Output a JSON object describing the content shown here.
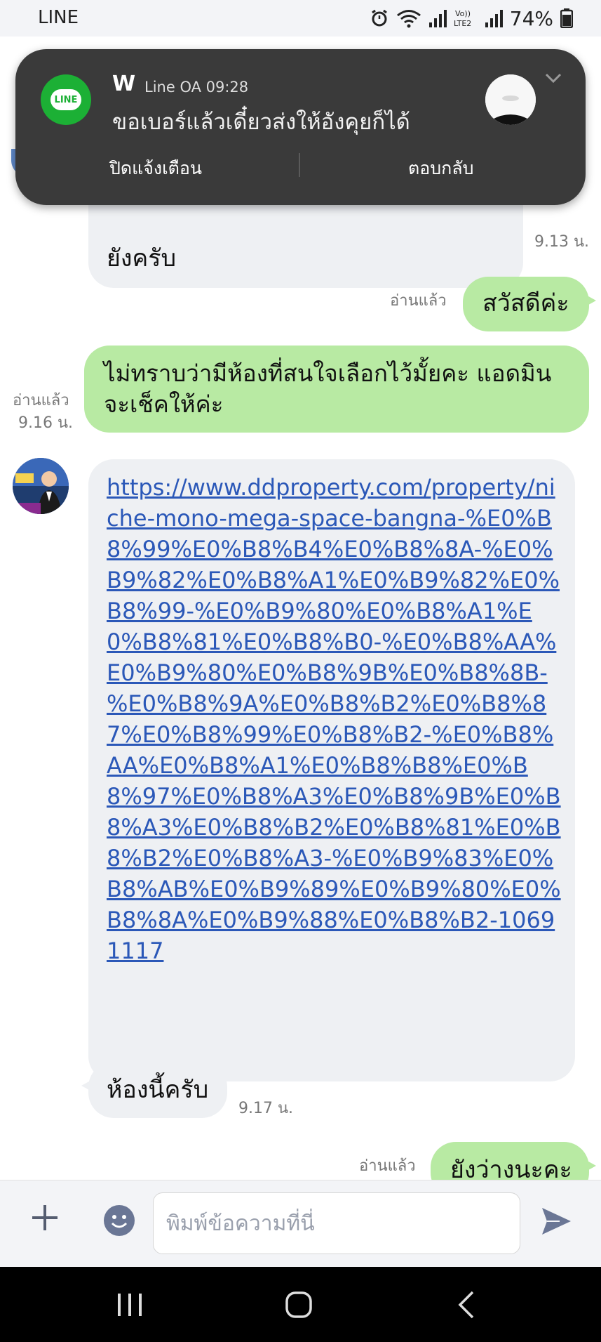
{
  "status_bar": {
    "app": "LINE",
    "battery_percent": "74%"
  },
  "notification": {
    "sender": "W",
    "source": "Line OA   09:28",
    "message": "ขอเบอร์แล้วเดี๋ยวส่งให้อังคุยก็ได้",
    "dismiss_label": "ปิดแจ้งเตือน",
    "reply_label": "ตอบกลับ"
  },
  "messages": {
    "m1": {
      "text": "ยังครับ",
      "time": "9.13 น."
    },
    "m2": {
      "text": "สวัสดีค่ะ",
      "read": "อ่านแล้ว"
    },
    "m3": {
      "text_line1": "ไม่ทราบว่ามีห้องที่สนใจเลือกไว้มั้ยคะ แอดมิน",
      "text_line2": "จะเช็คให้ค่ะ",
      "read": "อ่านแล้ว",
      "time": "9.16 น."
    },
    "m4": {
      "url": "https://www.ddproperty.com/property/niche-mono-mega-space-bangna-%E0%B8%99%E0%B8%B4%E0%B8%8A-%E0%B9%82%E0%B8%A1%E0%B9%82%E0%B8%99-%E0%B9%80%E0%B8%A1%E0%B8%81%E0%B8%B0-%E0%B8%AA%E0%B9%80%E0%B8%9B%E0%B8%8B-%E0%B8%9A%E0%B8%B2%E0%B8%87%E0%B8%99%E0%B8%B2-%E0%B8%AA%E0%B8%A1%E0%B8%B8%E0%B8%97%E0%B8%A3%E0%B8%9B%E0%B8%A3%E0%B8%B2%E0%B8%81%E0%B8%B2%E0%B8%A3-%E0%B9%83%E0%B8%AB%E0%B9%89%E0%B9%80%E0%B8%8A%E0%B9%88%E0%B8%B2-10691117"
    },
    "m5": {
      "text": "ห้องนี้ครับ",
      "time": "9.17 น."
    },
    "m6": {
      "text": "ยังว่างนะคะ",
      "read": "อ่านแล้ว"
    }
  },
  "input": {
    "placeholder": "พิมพ์ข้อความที่นี่"
  },
  "colors": {
    "outgoing_bubble": "#b8eaa3",
    "incoming_bubble": "#eef0f3",
    "link": "#2b58b8",
    "line_green": "#1cb035"
  }
}
